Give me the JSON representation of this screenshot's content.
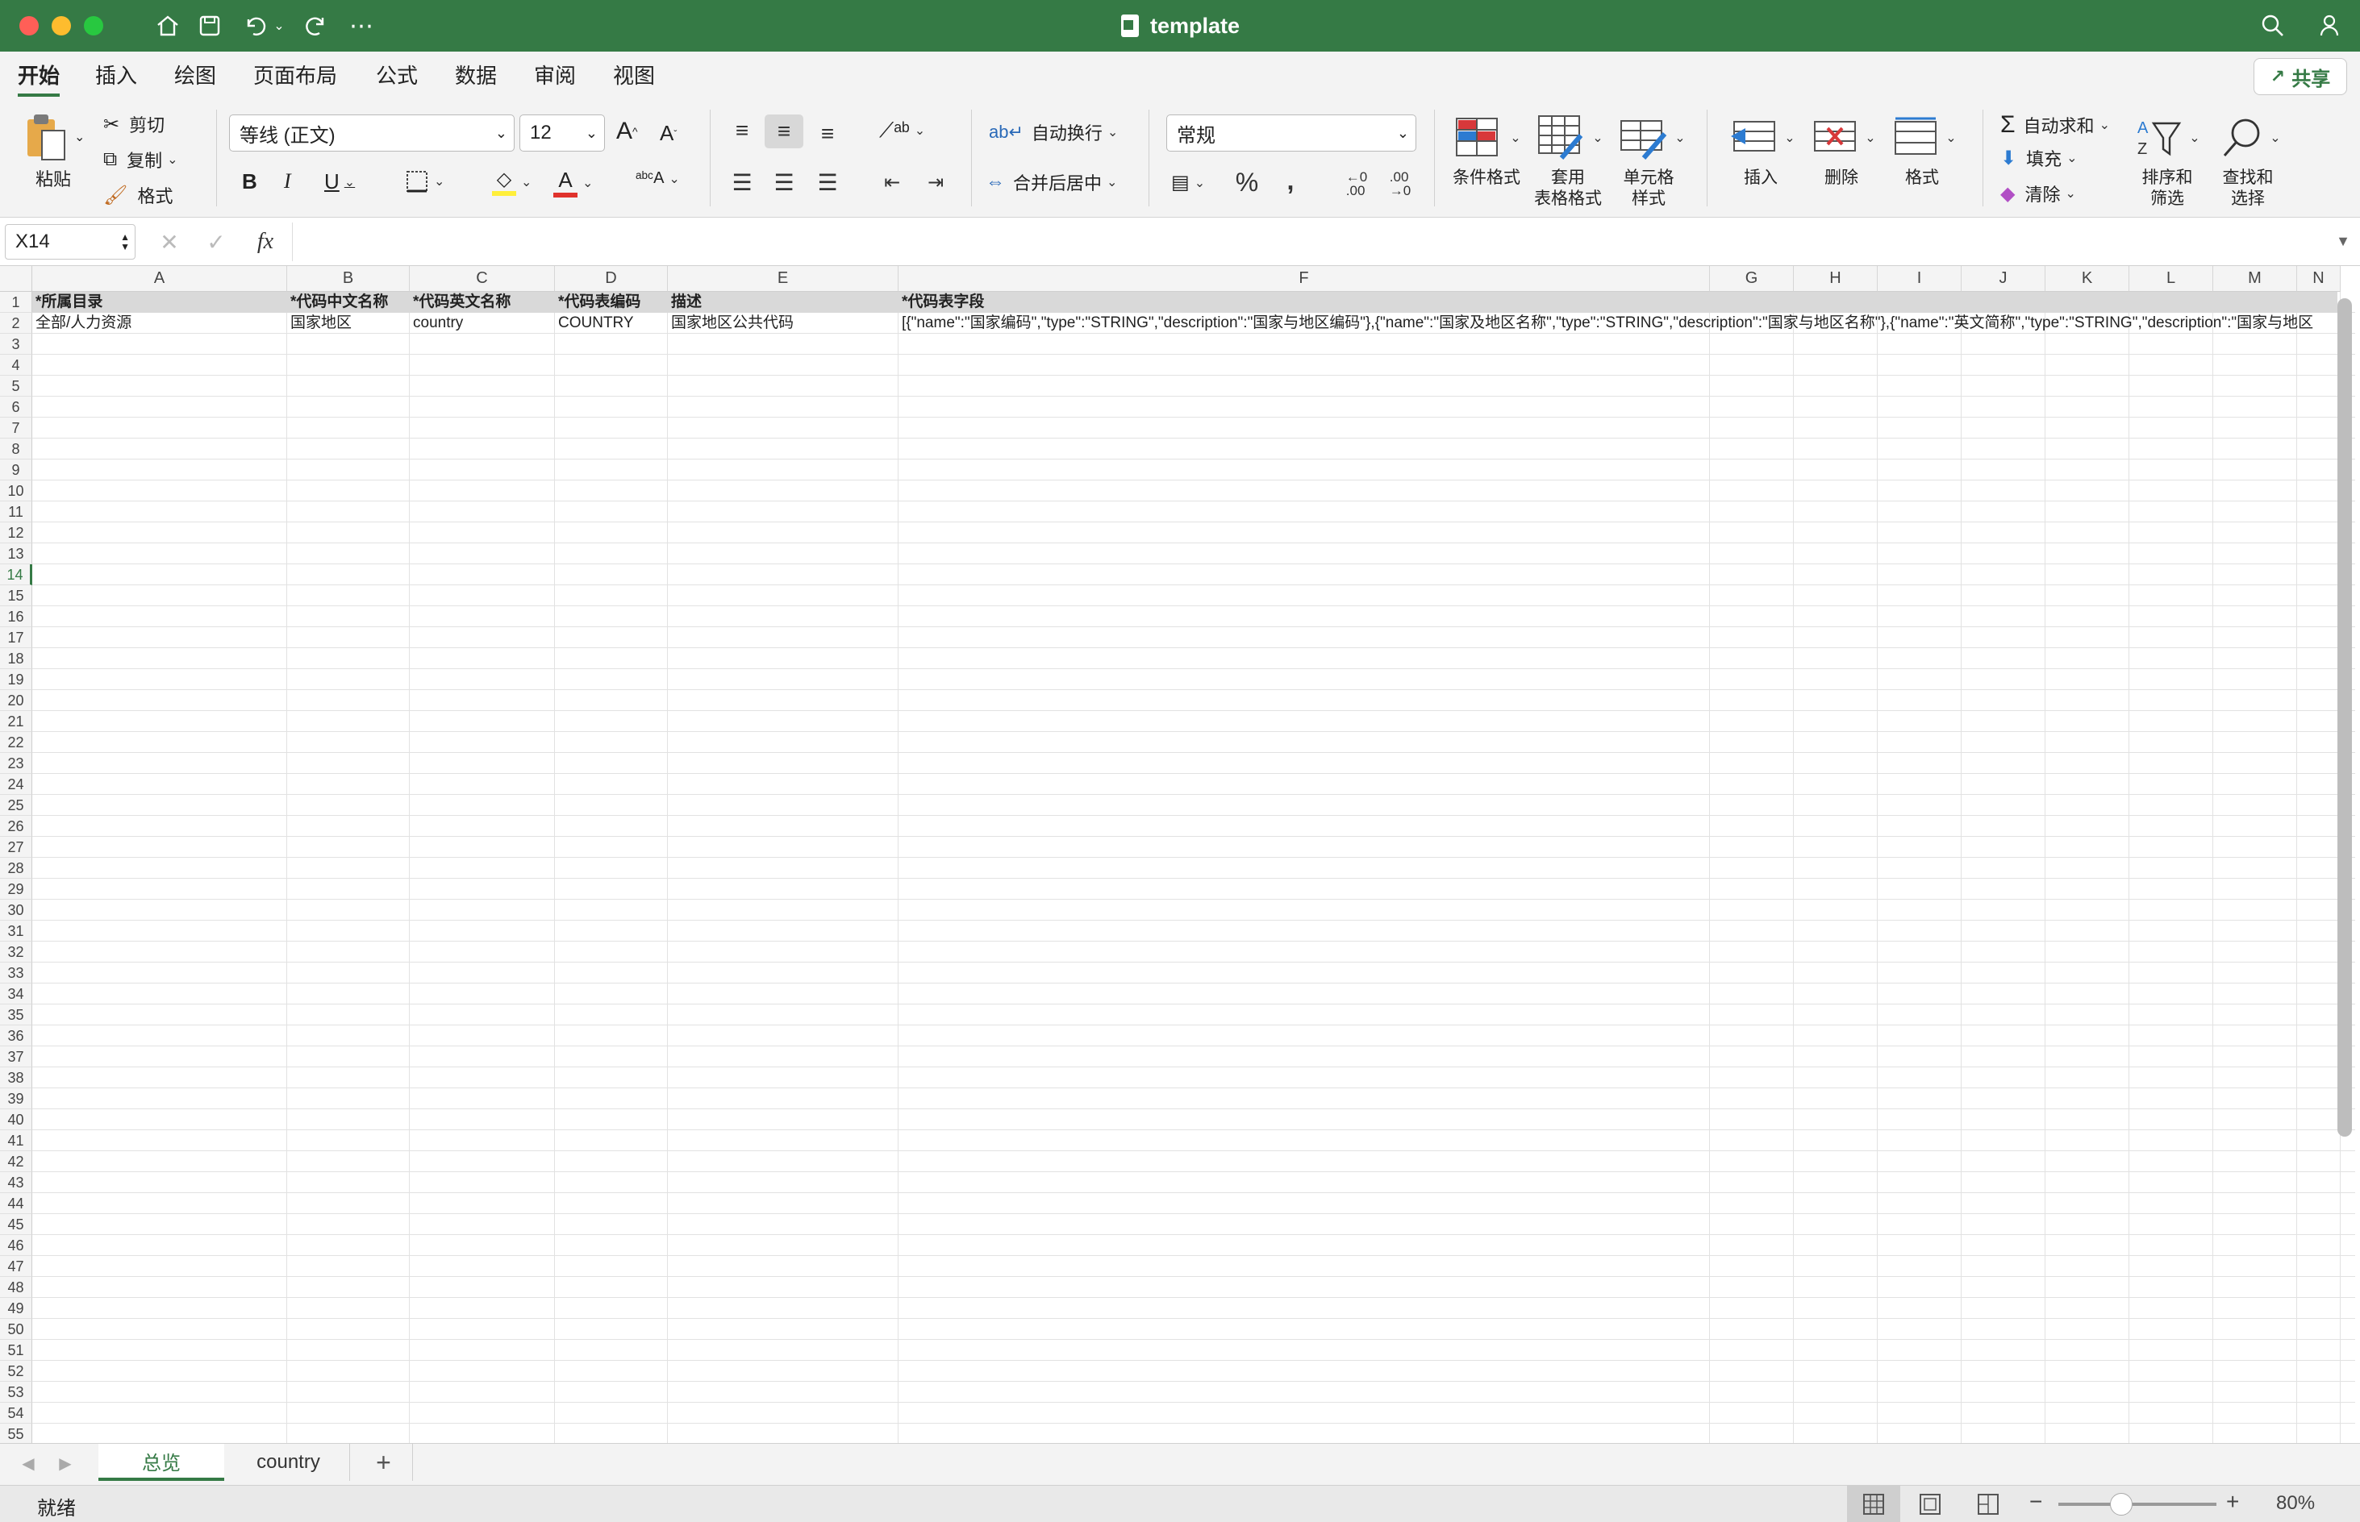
{
  "titlebar": {
    "title": "template"
  },
  "ribbon_tabs": [
    "开始",
    "插入",
    "绘图",
    "页面布局",
    "公式",
    "数据",
    "审阅",
    "视图"
  ],
  "share_label": "共享",
  "clipboard": {
    "paste": "粘贴",
    "cut": "剪切",
    "copy": "复制",
    "format_painter": "格式"
  },
  "font": {
    "name": "等线 (正文)",
    "size": "12"
  },
  "alignment": {
    "wrap_text": "自动换行",
    "merge_center": "合并后居中"
  },
  "number": {
    "format": "常规"
  },
  "styles": {
    "conditional": "条件格式",
    "table_format": "套用\n表格格式",
    "cell_style": "单元格\n样式"
  },
  "cells": {
    "insert": "插入",
    "delete": "删除",
    "format": "格式"
  },
  "editing": {
    "autosum": "自动求和",
    "fill": "填充",
    "clear": "清除",
    "sort_filter": "排序和\n筛选",
    "find_select": "查找和\n选择"
  },
  "formula_bar": {
    "name_box": "X14",
    "fx": "fx",
    "value": ""
  },
  "grid": {
    "columns": [
      "A",
      "B",
      "C",
      "D",
      "E",
      "F",
      "G",
      "H",
      "I",
      "J",
      "K",
      "L",
      "M",
      "N"
    ],
    "header_row": [
      "*所属目录",
      "*代码中文名称",
      "*代码英文名称",
      "*代码表编码",
      "描述",
      "*代码表字段"
    ],
    "data_row": [
      "全部/人力资源",
      "国家地区",
      "country",
      "COUNTRY",
      "国家地区公共代码",
      "[{\"name\":\"国家编码\",\"type\":\"STRING\",\"description\":\"国家与地区编码\"},{\"name\":\"国家及地区名称\",\"type\":\"STRING\",\"description\":\"国家与地区名称\"},{\"name\":\"英文简称\",\"type\":\"STRING\",\"description\":\"国家与地区"
    ],
    "row_count": 55,
    "selected_row": 14
  },
  "sheets": [
    {
      "name": "总览",
      "active": true
    },
    {
      "name": "country",
      "active": false
    }
  ],
  "add_sheet": "+",
  "status": {
    "ready": "就绪",
    "zoom": "80%"
  },
  "colors": {
    "accent": "#357a45",
    "header_fill": "#d9d9d9"
  }
}
